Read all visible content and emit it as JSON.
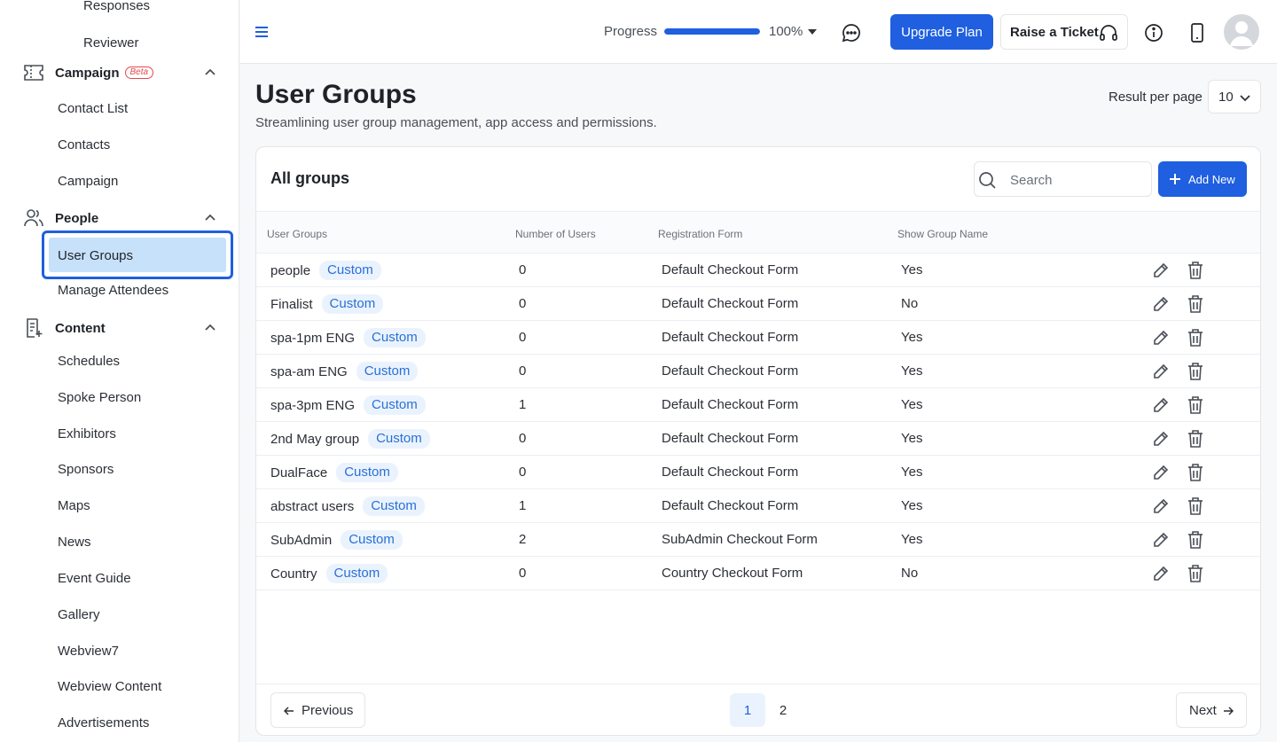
{
  "sidebar": {
    "top_items": [
      "Responses",
      "Reviewer"
    ],
    "campaign": {
      "label": "Campaign",
      "badge": "Beta",
      "items": [
        "Contact List",
        "Contacts",
        "Campaign"
      ]
    },
    "people": {
      "label": "People",
      "active_item": "User Groups",
      "items": [
        "Manage Attendees"
      ]
    },
    "content": {
      "label": "Content",
      "items": [
        "Schedules",
        "Spoke Person",
        "Exhibitors",
        "Sponsors",
        "Maps",
        "News",
        "Event Guide",
        "Gallery",
        "Webview7",
        "Webview Content",
        "Advertisements"
      ]
    }
  },
  "topbar": {
    "progress_label": "Progress",
    "progress_value": 100,
    "progress_text": "100%",
    "upgrade_label": "Upgrade Plan",
    "ticket_label": "Raise a Ticket"
  },
  "page": {
    "title": "User Groups",
    "subtitle": "Streamlining user group management, app access and permissions.",
    "rpp_label": "Result per page",
    "rpp_value": "10"
  },
  "card": {
    "title": "All groups",
    "search_placeholder": "Search",
    "add_label": "Add New",
    "columns": [
      "User Groups",
      "Number of Users",
      "Registration Form",
      "Show Group Name"
    ],
    "rows": [
      {
        "name": "people",
        "tag": "Custom",
        "users": "0",
        "form": "Default Checkout Form",
        "show": "Yes"
      },
      {
        "name": "Finalist",
        "tag": "Custom",
        "users": "0",
        "form": "Default Checkout Form",
        "show": "No"
      },
      {
        "name": "spa-1pm ENG",
        "tag": "Custom",
        "users": "0",
        "form": "Default Checkout Form",
        "show": "Yes"
      },
      {
        "name": "spa-am ENG",
        "tag": "Custom",
        "users": "0",
        "form": "Default Checkout Form",
        "show": "Yes"
      },
      {
        "name": "spa-3pm ENG",
        "tag": "Custom",
        "users": "1",
        "form": "Default Checkout Form",
        "show": "Yes"
      },
      {
        "name": "2nd May group",
        "tag": "Custom",
        "users": "0",
        "form": "Default Checkout Form",
        "show": "Yes"
      },
      {
        "name": "DualFace",
        "tag": "Custom",
        "users": "0",
        "form": "Default Checkout Form",
        "show": "Yes"
      },
      {
        "name": "abstract users",
        "tag": "Custom",
        "users": "1",
        "form": "Default Checkout Form",
        "show": "Yes"
      },
      {
        "name": "SubAdmin",
        "tag": "Custom",
        "users": "2",
        "form": "SubAdmin Checkout Form",
        "show": "Yes"
      },
      {
        "name": "Country",
        "tag": "Custom",
        "users": "0",
        "form": "Country Checkout Form",
        "show": "No"
      }
    ],
    "pagination": {
      "prev_label": "Previous",
      "next_label": "Next",
      "pages": [
        "1",
        "2"
      ],
      "current": "1"
    }
  },
  "colors": {
    "primary": "#1f5fe0",
    "tag_bg": "#eaf3fd",
    "tag_text": "#2a6fd6",
    "active_bg": "#c7e1fb",
    "beta": "#e5484d"
  }
}
